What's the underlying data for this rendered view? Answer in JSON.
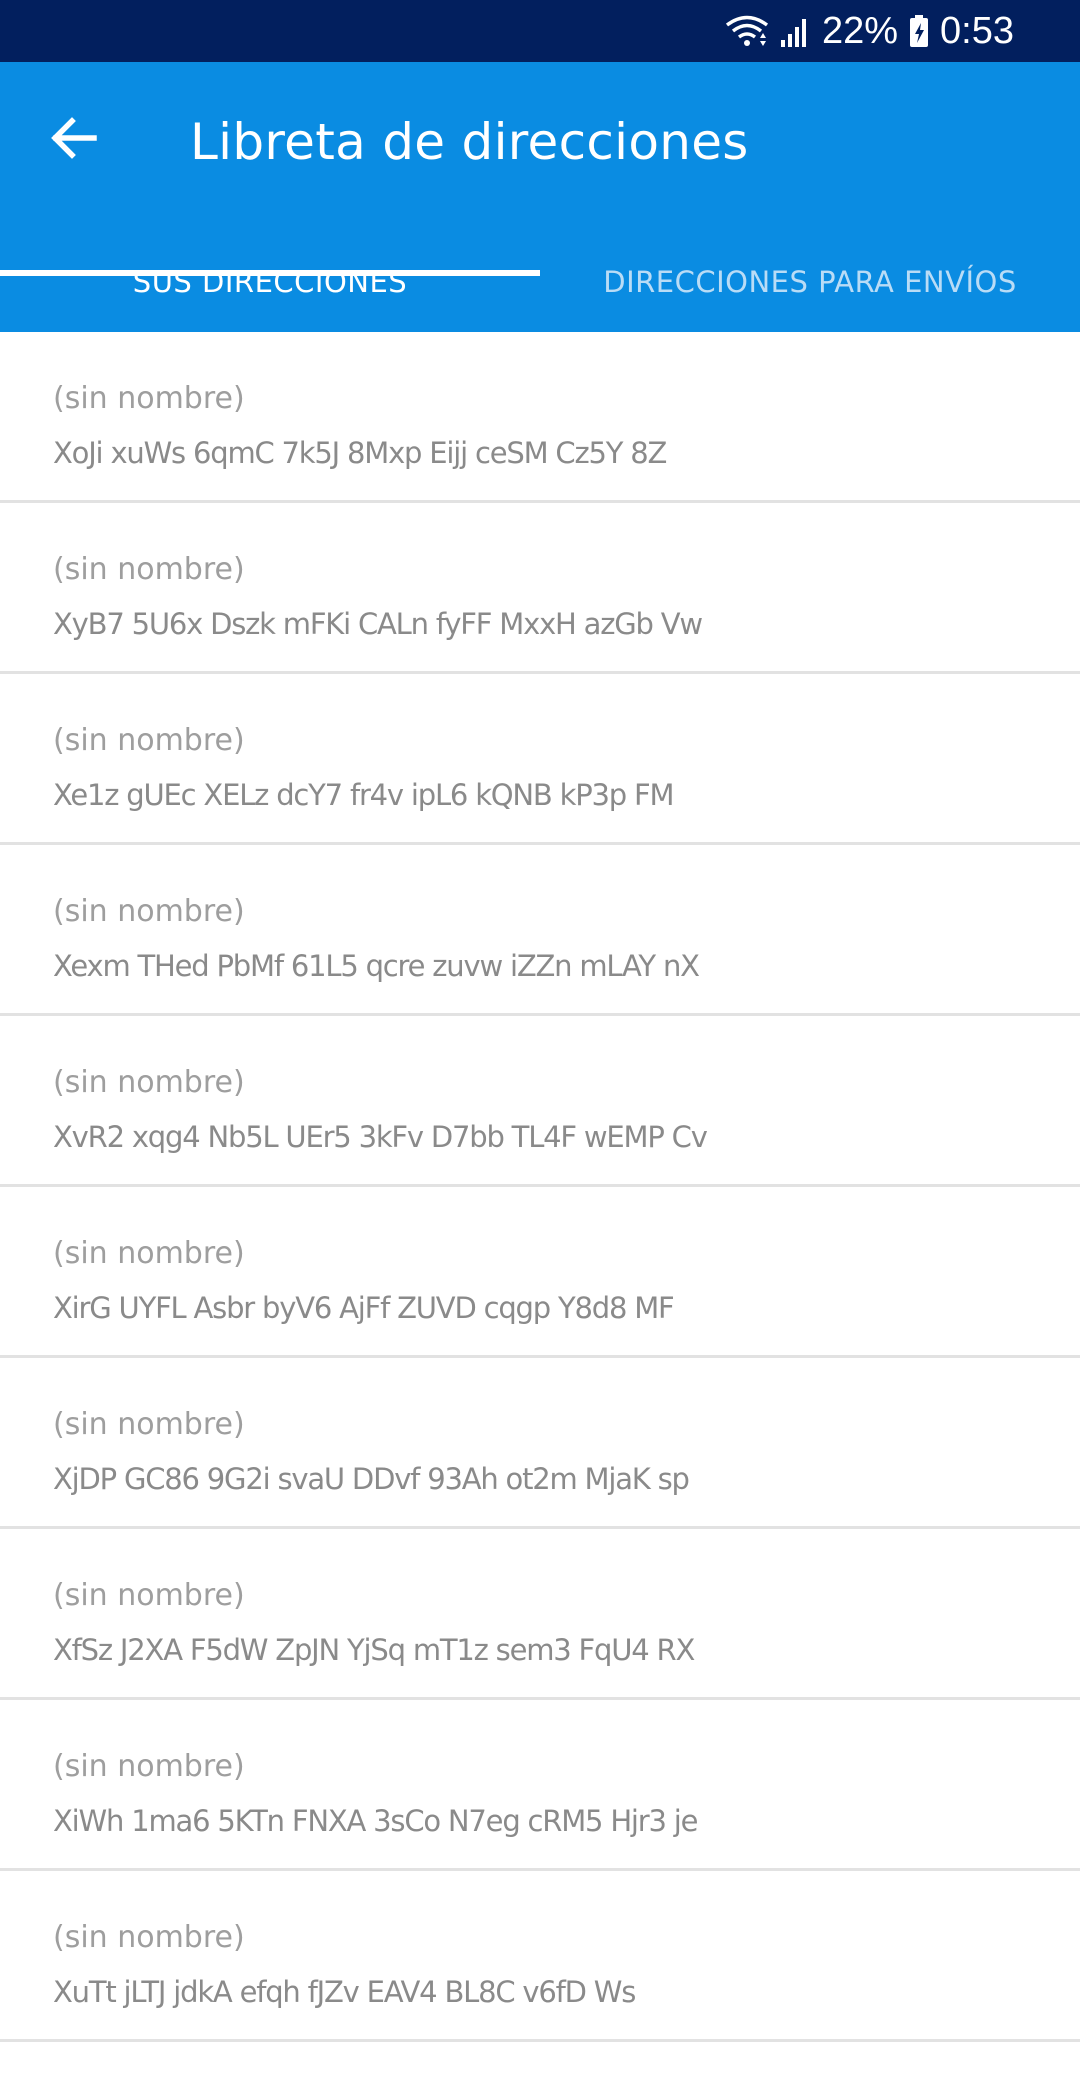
{
  "status_bar": {
    "battery": "22%",
    "time": "0:53",
    "icons": [
      "wifi-icon",
      "signal-icon",
      "battery-charging-icon"
    ]
  },
  "app_bar": {
    "back_icon": "arrow-left-icon",
    "title": "Libreta de direcciones",
    "background": "#0a8ce2"
  },
  "tabs": [
    {
      "label": "SUS DIRECCIONES",
      "selected": true
    },
    {
      "label": "DIRECCIONES PARA ENVÍOS",
      "selected": false
    }
  ],
  "addresses": [
    {
      "name": "(sin nombre)",
      "address": "XoJi xuWs 6qmC 7k5J 8Mxp Eijj ceSM Cz5Y 8Z"
    },
    {
      "name": "(sin nombre)",
      "address": "XyB7 5U6x Dszk mFKi CALn fyFF MxxH azGb Vw"
    },
    {
      "name": "(sin nombre)",
      "address": "Xe1z gUEc XELz dcY7 fr4v ipL6 kQNB kP3p FM"
    },
    {
      "name": "(sin nombre)",
      "address": "Xexm THed PbMf 61L5 qcre zuvw iZZn mLAY nX"
    },
    {
      "name": "(sin nombre)",
      "address": "XvR2 xqg4 Nb5L UEr5 3kFv D7bb TL4F wEMP Cv"
    },
    {
      "name": "(sin nombre)",
      "address": "XirG UYFL Asbr byV6 AjFf ZUVD cqgp Y8d8 MF"
    },
    {
      "name": "(sin nombre)",
      "address": "XjDP GC86 9G2i svaU DDvf 93Ah ot2m MjaK sp"
    },
    {
      "name": "(sin nombre)",
      "address": "XfSz J2XA F5dW ZpJN YjSq mT1z sem3 FqU4 RX"
    },
    {
      "name": "(sin nombre)",
      "address": "XiWh 1ma6 5KTn FNXA 3sCo N7eg cRM5 Hjr3 je"
    },
    {
      "name": "(sin nombre)",
      "address": "XuTt jLTJ jdkA efqh fJZv EAV4 BL8C v6fD Ws"
    }
  ]
}
